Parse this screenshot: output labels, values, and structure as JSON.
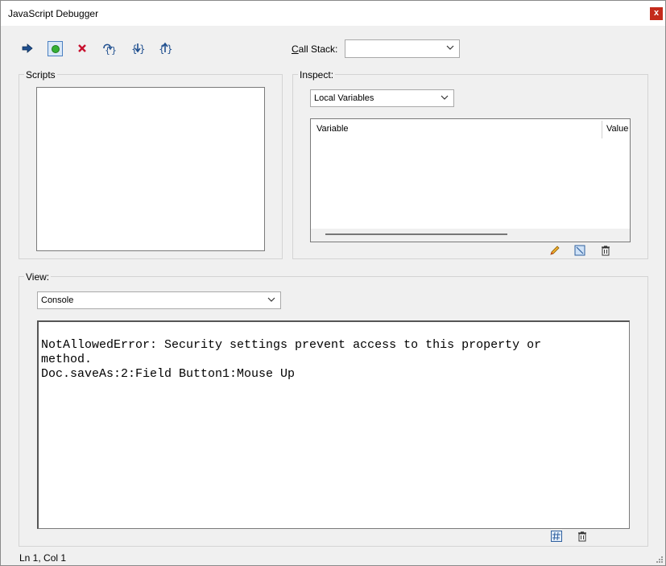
{
  "window": {
    "title": "JavaScript Debugger",
    "close_glyph": "x"
  },
  "toolbar": {
    "buttons": [
      {
        "name": "resume-button",
        "icon": "arrow-right-icon"
      },
      {
        "name": "pause-button",
        "icon": "green-dot-icon",
        "selected": true
      },
      {
        "name": "quit-button",
        "icon": "red-x-icon"
      },
      {
        "name": "step-over-button",
        "icon": "step-over-icon"
      },
      {
        "name": "step-into-button",
        "icon": "step-into-icon"
      },
      {
        "name": "step-out-button",
        "icon": "step-out-icon"
      }
    ],
    "call_stack_label_underline": "C",
    "call_stack_label_rest": "all Stack:",
    "call_stack_value": ""
  },
  "scripts": {
    "title": "Scripts"
  },
  "inspect": {
    "title": "Inspect:",
    "dropdown_value": "Local Variables",
    "columns": [
      "Variable",
      "Value"
    ]
  },
  "view": {
    "title": "View:",
    "dropdown_value": "Console",
    "console_lines": [
      "NotAllowedError: Security settings prevent access to this property or",
      "method.",
      "Doc.saveAs:2:Field Button1:Mouse Up"
    ]
  },
  "status": {
    "position": "Ln 1, Col 1"
  },
  "colors": {
    "accent": "#4a7fc1",
    "close": "#c42b1c"
  }
}
